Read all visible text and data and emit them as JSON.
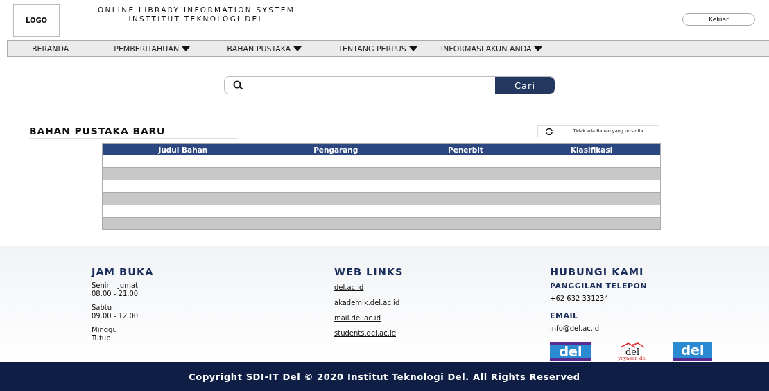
{
  "header": {
    "logo": "LOGO",
    "title_lines": [
      "ONLINE LIBRARY INFORMATION SYSTEM",
      "INSTTITUT TEKNOLOGI DEL"
    ],
    "logout_button": "Keluar"
  },
  "nav": [
    {
      "label": "BERANDA",
      "dropdown": false
    },
    {
      "label": "PEMBERITAHUAN",
      "dropdown": true
    },
    {
      "label": "BAHAN PUSTAKA",
      "dropdown": true
    },
    {
      "label": "TENTANG PERPUS",
      "dropdown": true
    },
    {
      "label": "INFORMASI AKUN ANDA",
      "dropdown": true
    }
  ],
  "search": {
    "button": "Cari"
  },
  "section": {
    "title": "BAHAN PUSTAKA BARU",
    "status": "Tidak ada Bahan yang tersedia"
  },
  "table": {
    "columns": [
      "Judul Bahan",
      "Pengarang",
      "Penerbit",
      "Klasifikasi"
    ]
  },
  "footer": {
    "hours": {
      "title": "JAM BUKA",
      "entries": [
        {
          "day": "Senin - Jumat",
          "time": "08.00 - 21.00"
        },
        {
          "day": "Sabtu",
          "time": "09.00 - 12.00"
        },
        {
          "day": "Minggu",
          "time": "Tutup"
        }
      ]
    },
    "links": {
      "title": "WEB LINKS",
      "items": [
        "del.ac.id",
        "akademik.del.ac.id",
        "mail.del.ac.id",
        "students.del.ac.id"
      ]
    },
    "contact": {
      "title": "HUBUNGI KAMI",
      "phone_label": "PANGGILAN TELEPON",
      "phone": "+62 632 331234",
      "email_label": "EMAIL",
      "email": "info@del.ac.id"
    },
    "logos": [
      {
        "kind": "institut",
        "text": "del"
      },
      {
        "kind": "yayasan",
        "text": "del",
        "subtext": "yayasan del"
      },
      {
        "kind": "sma",
        "text": "del"
      }
    ]
  },
  "copyright": "Copyright SDI-IT Del © 2020 Institut Teknologi Del. All Rights Reserved"
}
